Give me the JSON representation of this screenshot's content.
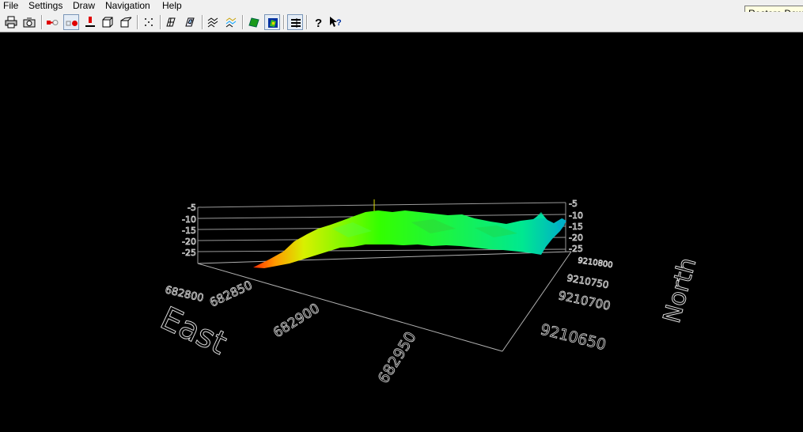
{
  "menu": {
    "file": "File",
    "settings": "Settings",
    "draw": "Draw",
    "navigation": "Navigation",
    "help": "Help"
  },
  "tooltip": "Restore Down",
  "toolbar": {
    "icons": [
      "print-icon",
      "camera-icon",
      "record-start-icon",
      "record-stop-icon",
      "marker-icon",
      "cube-icon",
      "box-open-icon",
      "points-icon",
      "wireframe-icon",
      "surface-icon",
      "rotate-icon",
      "layers-icon",
      "terrain-green-icon",
      "terrain-color-icon",
      "legend-icon",
      "help-icon",
      "context-help-icon"
    ]
  },
  "plot3d": {
    "z_ticks": [
      "-5",
      "-10",
      "-15",
      "-20",
      "-25"
    ],
    "east_ticks": [
      "682800",
      "682850",
      "682900",
      "682950"
    ],
    "north_ticks": [
      "9210800",
      "9210750",
      "9210700",
      "9210650"
    ],
    "east_label": "East",
    "north_label": "North",
    "colormap": [
      "#ff2a00",
      "#ff9a00",
      "#d8f000",
      "#33ff00",
      "#00e890",
      "#00a8d0"
    ]
  }
}
